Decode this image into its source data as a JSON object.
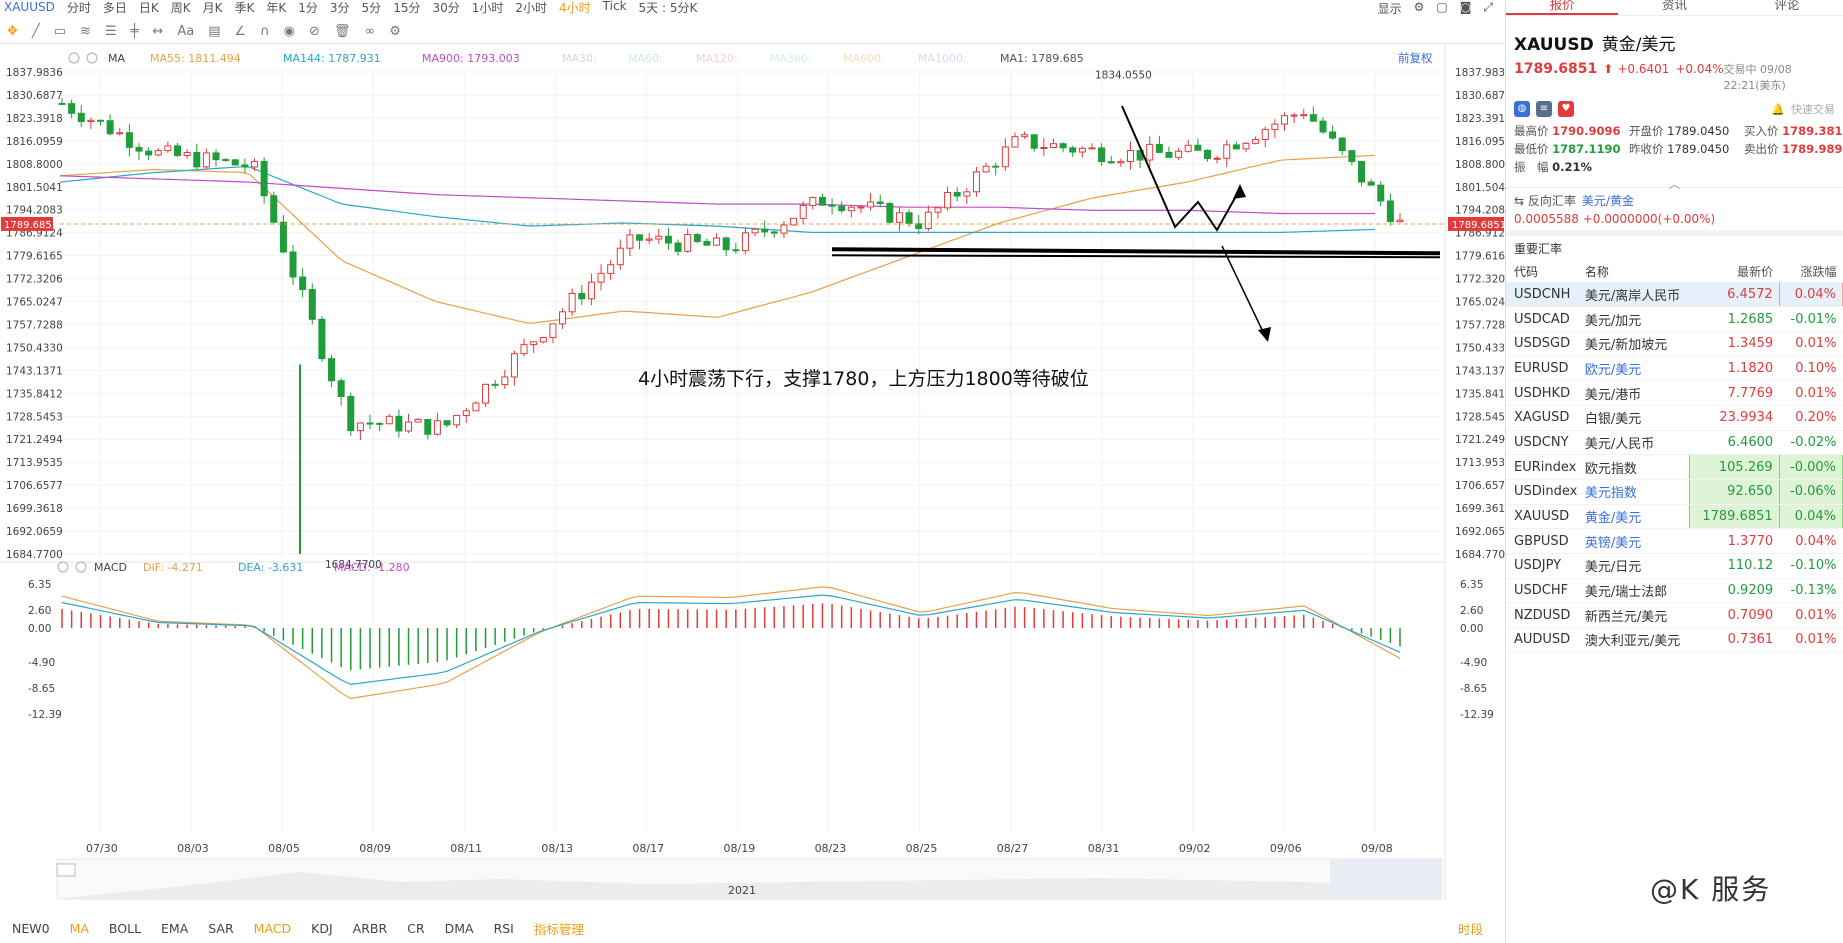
{
  "topbar": {
    "symbol": "XAUUSD",
    "periods": [
      "分时",
      "多日",
      "日K",
      "周K",
      "月K",
      "季K",
      "年K",
      "1分",
      "3分",
      "5分",
      "15分",
      "30分",
      "1小时",
      "2小时",
      "4小时",
      "Tick",
      "5天 : 5分K"
    ],
    "active_period": "4小时",
    "display_label": "显示"
  },
  "indicators_main": {
    "name": "MA",
    "ma55": "MA55: 1811.494",
    "ma144": "MA144: 1787.931",
    "ma900": "MA900: 1793.003",
    "ma30": "MA30:",
    "ma60": "MA60:",
    "ma120": "MA120:",
    "ma360": "MA360:",
    "ma600": "MA600:",
    "ma1000": "MA1000:",
    "ma1": "MA1: 1789.685",
    "fq": "前复权"
  },
  "indicators_sub": {
    "name": "MACD",
    "dif": "DIF: -4.271",
    "dea": "DEA: -3.631",
    "macd": "MACD: -1.280"
  },
  "price_axis": [
    "1837.9836",
    "1830.6877",
    "1823.3918",
    "1816.0959",
    "1808.8000",
    "1801.5041",
    "1794.2083",
    "1786.9124",
    "1779.6165",
    "1772.3206",
    "1765.0247",
    "1757.7288",
    "1750.4330",
    "1743.1371",
    "1735.8412",
    "1728.5453",
    "1721.2494",
    "1713.9535",
    "1706.6577",
    "1699.3618",
    "1692.0659",
    "1684.7700"
  ],
  "current_price": "1789.6851",
  "high_label": "1834.0550",
  "low_label": "1684.7700",
  "macd_axis": [
    "6.35",
    "2.60",
    "0.00",
    "-4.90",
    "-8.65",
    "-12.39"
  ],
  "date_axis": [
    "07/30",
    "08/03",
    "08/05",
    "08/09",
    "08/11",
    "08/13",
    "08/17",
    "08/19",
    "08/23",
    "08/25",
    "08/27",
    "08/31",
    "09/02",
    "09/06",
    "09/08"
  ],
  "annotation": "4小时震荡下行，支撑1780，上方压力1800等待破位",
  "navigator_year": "2021",
  "bottombar": {
    "items": [
      "NEW0",
      "MA",
      "BOLL",
      "EMA",
      "SAR",
      "MACD",
      "KDJ",
      "ARBR",
      "CR",
      "DMA",
      "RSI"
    ],
    "active": [
      "MA",
      "MACD"
    ],
    "manage": "指标管理",
    "right": "时段"
  },
  "panel": {
    "tabs": [
      "报价",
      "资讯",
      "评论"
    ],
    "symbol": "XAUUSD",
    "name": "黄金/美元",
    "price": "1789.6851",
    "change": "+0.6401",
    "pct": "+0.04%",
    "time": "交易中 09/08 22:21(美东)",
    "fast_trade": "快速交易",
    "stats": {
      "high_label": "最高价",
      "high": "1790.9096",
      "open_label": "开盘价",
      "open": "1789.0450",
      "bid_label": "买入价",
      "bid": "1789.3811",
      "low_label": "最低价",
      "low": "1787.1190",
      "prev_label": "昨收价",
      "prev": "1789.0450",
      "ask_label": "卖出价",
      "ask": "1789.9890",
      "amp_label": "振　幅",
      "amp": "0.21%"
    },
    "inverse": {
      "label": "反向汇率",
      "pair": "美元/黄金",
      "value": "0.0005588",
      "change": "+0.0000000(+0.00%)"
    },
    "section_title": "重要汇率",
    "table_headers": [
      "代码",
      "名称",
      "最新价",
      "涨跌幅"
    ],
    "rows": [
      {
        "code": "USDCNH",
        "name": "美元/离岸人民币",
        "price": "6.4572",
        "pct": "0.04%",
        "dir": "up"
      },
      {
        "code": "USDCAD",
        "name": "美元/加元",
        "price": "1.2685",
        "pct": "-0.01%",
        "dir": "dn"
      },
      {
        "code": "USDSGD",
        "name": "美元/新加坡元",
        "price": "1.3459",
        "pct": "0.01%",
        "dir": "up"
      },
      {
        "code": "EURUSD",
        "name": "欧元/美元",
        "price": "1.1820",
        "pct": "0.10%",
        "dir": "up"
      },
      {
        "code": "USDHKD",
        "name": "美元/港币",
        "price": "7.7769",
        "pct": "0.01%",
        "dir": "up"
      },
      {
        "code": "XAGUSD",
        "name": "白银/美元",
        "price": "23.9934",
        "pct": "0.20%",
        "dir": "up"
      },
      {
        "code": "USDCNY",
        "name": "美元/人民币",
        "price": "6.4600",
        "pct": "-0.02%",
        "dir": "dn"
      },
      {
        "code": "EURindex",
        "name": "欧元指数",
        "price": "105.269",
        "pct": "-0.00%",
        "dir": "dn"
      },
      {
        "code": "USDindex",
        "name": "美元指数",
        "price": "92.650",
        "pct": "-0.06%",
        "dir": "dn"
      },
      {
        "code": "XAUUSD",
        "name": "黄金/美元",
        "price": "1789.6851",
        "pct": "0.04%",
        "dir": "dn"
      },
      {
        "code": "GBPUSD",
        "name": "英镑/美元",
        "price": "1.3770",
        "pct": "0.04%",
        "dir": "up"
      },
      {
        "code": "USDJPY",
        "name": "美元/日元",
        "price": "110.12",
        "pct": "-0.10%",
        "dir": "dn"
      },
      {
        "code": "USDCHF",
        "name": "美元/瑞士法郎",
        "price": "0.9209",
        "pct": "-0.13%",
        "dir": "dn"
      },
      {
        "code": "NZDUSD",
        "name": "新西兰元/美元",
        "price": "0.7090",
        "pct": "0.01%",
        "dir": "up"
      },
      {
        "code": "AUDUSD",
        "name": "澳大利亚元/美元",
        "price": "0.7361",
        "pct": "0.01%",
        "dir": "up"
      }
    ]
  },
  "watermark": "@K 服务",
  "colors": {
    "up": "#e23b3b",
    "down": "#1f9d3a",
    "ma55": "#e8a04a",
    "ma144": "#2aa6c8",
    "ma900": "#c04cc9",
    "macd_dif": "#e8a04a",
    "macd_dea": "#2aa6c8",
    "accent": "#f39c12"
  },
  "chart_data": {
    "type": "line",
    "title": "",
    "xlabel": "",
    "ylabel": "",
    "ylim": [
      1684.77,
      1837.9836
    ],
    "x": [
      "07/30",
      "08/03",
      "08/05",
      "08/09",
      "08/11",
      "08/13",
      "08/17",
      "08/19",
      "08/23",
      "08/25",
      "08/27",
      "08/31",
      "09/02",
      "09/06",
      "09/08"
    ],
    "series": [
      {
        "name": "MA1",
        "values": [
          1828,
          1812,
          1808,
          1727,
          1725,
          1755,
          1785,
          1782,
          1798,
          1790,
          1816,
          1812,
          1812,
          1826,
          1789.6851
        ]
      },
      {
        "name": "MA55",
        "values": [
          1805,
          1807,
          1806,
          1778,
          1765,
          1758,
          1762,
          1760,
          1768,
          1779,
          1790,
          1798,
          1803,
          1810,
          1811.494
        ]
      },
      {
        "name": "MA144",
        "values": [
          1803,
          1806,
          1808,
          1796,
          1792,
          1789,
          1790,
          1789,
          1787,
          1787,
          1787,
          1787,
          1787,
          1787,
          1787.931
        ]
      },
      {
        "name": "MA900",
        "values": [
          1805,
          1804,
          1803,
          1801,
          1799,
          1798,
          1797,
          1796,
          1796,
          1795,
          1795,
          1794,
          1794,
          1793,
          1793.003
        ]
      }
    ]
  }
}
